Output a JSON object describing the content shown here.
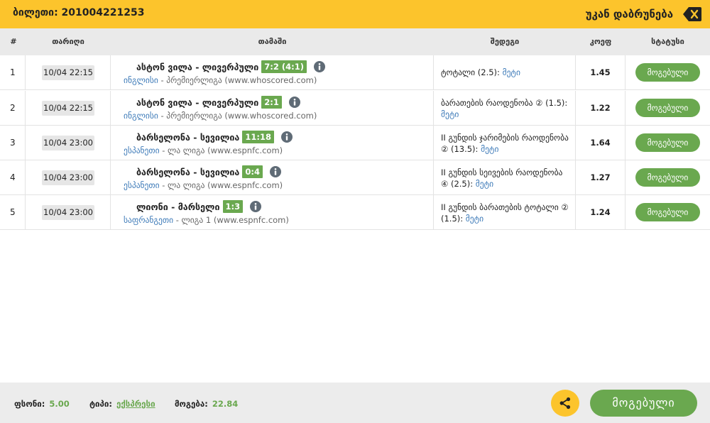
{
  "header": {
    "ticket_title": "ბილეთი: 201004221253",
    "back_label": "უკან დაბრუნება",
    "accent_color": "#fcc42c"
  },
  "columns": {
    "index": "#",
    "date": "თარიღი",
    "match": "თამაში",
    "bet": "შედეგი",
    "odds": "კოეფ",
    "status": "სტატუსი"
  },
  "rows": [
    {
      "index": "1",
      "date": "10/04 22:15",
      "match": "ასტონ ვილა - ლივერპული",
      "score": "7:2 (4:1)",
      "country": "ინგლისი",
      "league": "- პრემიერლიგა (www.whoscored.com)",
      "bet_text": "ტოტალი (2.5):",
      "bet_pick": "მეტი",
      "odds": "1.45",
      "status": "მოგებული"
    },
    {
      "index": "2",
      "date": "10/04 22:15",
      "match": "ასტონ ვილა - ლივერპული",
      "score": "2:1",
      "country": "ინგლისი",
      "league": "- პრემიერლიგა (www.whoscored.com)",
      "bet_text": "ბარათების რაოდენობა ② (1.5):",
      "bet_pick": "მეტი",
      "odds": "1.22",
      "status": "მოგებული"
    },
    {
      "index": "3",
      "date": "10/04 23:00",
      "match": "ბარსელონა - სევილია",
      "score": "11:18",
      "country": "ესპანეთი",
      "league": "- ლა ლიგა (www.espnfc.com)",
      "bet_text": "II გუნდის ჯარიმების რაოდენობა ② (13.5):",
      "bet_pick": "მეტი",
      "odds": "1.64",
      "status": "მოგებული"
    },
    {
      "index": "4",
      "date": "10/04 23:00",
      "match": "ბარსელონა - სევილია",
      "score": "0:4",
      "country": "ესპანეთი",
      "league": "- ლა ლიგა (www.espnfc.com)",
      "bet_text": "II გუნდის სეივების რაოდენობა ④ (2.5):",
      "bet_pick": "მეტი",
      "odds": "1.27",
      "status": "მოგებული"
    },
    {
      "index": "5",
      "date": "10/04 23:00",
      "match": "ლიონი - მარსელი",
      "score": "1:3",
      "country": "საფრანგეთი",
      "league": "- ლიგა 1 (www.espnfc.com)",
      "bet_text": "II გუნდის ბარათების ტოტალი ② (1.5):",
      "bet_pick": "მეტი",
      "odds": "1.24",
      "status": "მოგებული"
    }
  ],
  "footer": {
    "stake_label": "ფსონი:",
    "stake_value": "5.00",
    "type_label": "ტიპი:",
    "type_value": "ექსპრესი",
    "win_label": "მოგება:",
    "win_value": "22.84",
    "status_label": "მოგებული",
    "share_icon": "share-icon"
  },
  "colors": {
    "win_green": "#6aa84f",
    "link_blue": "#3d7ab8",
    "header_gray": "#eaeaea"
  }
}
